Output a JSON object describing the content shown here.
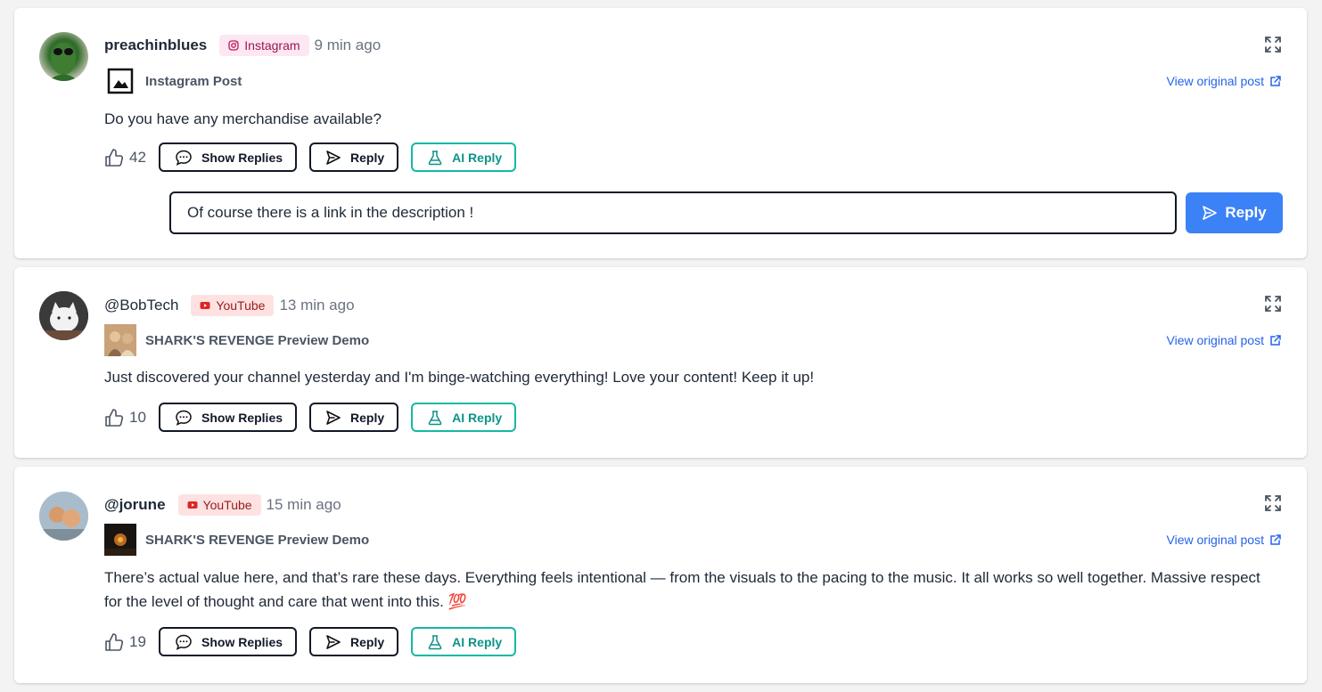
{
  "comments": [
    {
      "username": "preachinblues",
      "platform": "Instagram",
      "platform_icon": "instagram-icon",
      "time": "9 min ago",
      "post_title": "Instagram Post",
      "view_link": "View original post",
      "text": "Do you have any merchandise available?",
      "likes": "42",
      "show_replies": "Show Replies",
      "reply": "Reply",
      "ai_reply": "AI Reply",
      "reply_input_value": "Of course there is a link in the description !",
      "reply_submit": "Reply"
    },
    {
      "username": "@BobTech",
      "platform": "YouTube",
      "platform_icon": "youtube-icon",
      "time": "13 min ago",
      "post_title": "SHARK'S REVENGE Preview Demo",
      "view_link": "View original post",
      "text": "Just discovered your channel yesterday and I'm binge-watching everything! Love your content! Keep it up!",
      "likes": "10",
      "show_replies": "Show Replies",
      "reply": "Reply",
      "ai_reply": "AI Reply"
    },
    {
      "username": "@jorune",
      "platform": "YouTube",
      "platform_icon": "youtube-icon",
      "time": "15 min ago",
      "post_title": "SHARK'S REVENGE Preview Demo",
      "view_link": "View original post",
      "text": "There’s actual value here, and that’s rare these days. Everything feels intentional — from the visuals to the pacing to the music. It all works so well together. Massive respect for the level of thought and care that went into this. 💯",
      "likes": "19",
      "show_replies": "Show Replies",
      "reply": "Reply",
      "ai_reply": "AI Reply"
    }
  ],
  "colors": {
    "accent_blue": "#3b82f6",
    "link_blue": "#2563eb",
    "ai_teal": "#14b8a6",
    "instagram_badge_bg": "#fce7f3",
    "youtube_badge_bg": "#fee2e2"
  }
}
